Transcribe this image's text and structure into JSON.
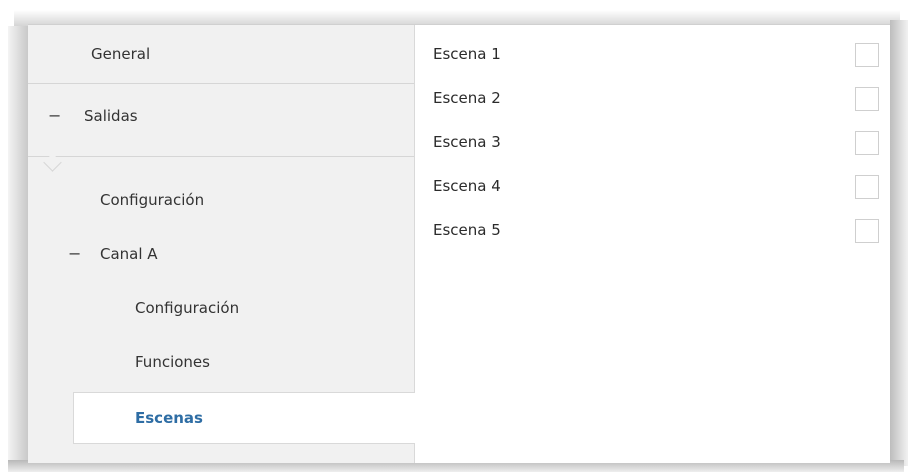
{
  "nav": {
    "general": "General",
    "outputs": "Salidas",
    "outputs_config": "Configuración",
    "channel_a": "Canal A",
    "channel_config": "Configuración",
    "functions": "Funciones",
    "scenes": "Escenas",
    "collapse_symbol": "−"
  },
  "scenes": [
    {
      "label": "Escena 1",
      "checked": false
    },
    {
      "label": "Escena 2",
      "checked": false
    },
    {
      "label": "Escena 3",
      "checked": false
    },
    {
      "label": "Escena 4",
      "checked": false
    },
    {
      "label": "Escena 5",
      "checked": false
    }
  ],
  "colors": {
    "sidebar_bg": "#f1f1f1",
    "active_text": "#2e6da4",
    "text": "#333333"
  }
}
